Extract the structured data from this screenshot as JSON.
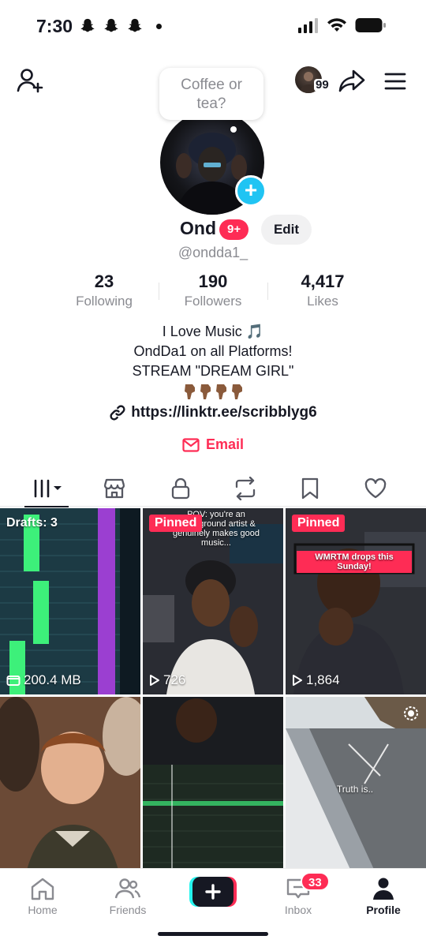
{
  "status_bar": {
    "time": "7:30"
  },
  "top_nav": {
    "viewer_count": "99"
  },
  "note": {
    "line1": "Coffee or",
    "line2": "tea?"
  },
  "profile": {
    "display_name": "Ond",
    "badge": "9+",
    "edit_label": "Edit",
    "handle": "@ondda1_"
  },
  "stats": [
    {
      "value": "23",
      "label": "Following"
    },
    {
      "value": "190",
      "label": "Followers"
    },
    {
      "value": "4,417",
      "label": "Likes"
    }
  ],
  "bio": {
    "line1": "I Love Music 🎵",
    "line2": "OndDa1 on all Platforms!",
    "line3": "STREAM \"DREAM GIRL\"",
    "link": "https://linktr.ee/scribblyg6",
    "email_label": "Email"
  },
  "tabs": [
    "videos-tab",
    "shop-tab",
    "private-tab",
    "reposts-tab",
    "favorites-tab",
    "liked-tab"
  ],
  "grid": {
    "drafts_label": "Drafts: 3",
    "drafts_size": "200.4 MB",
    "pinned_label": "Pinned",
    "video2_views": "726",
    "video3_views": "1,864",
    "video2_caption": "POV: you're an underground artist & genuinely makes good music...",
    "video3_caption": "WMRTM drops this Sunday!",
    "video6_caption": "Truth is.."
  },
  "bottom_nav": {
    "home": "Home",
    "friends": "Friends",
    "inbox": "Inbox",
    "inbox_badge": "33",
    "profile": "Profile"
  },
  "colors": {
    "accent": "#fe2c55",
    "story_blue": "#20c4f3",
    "muted_text": "#8a8b91"
  }
}
